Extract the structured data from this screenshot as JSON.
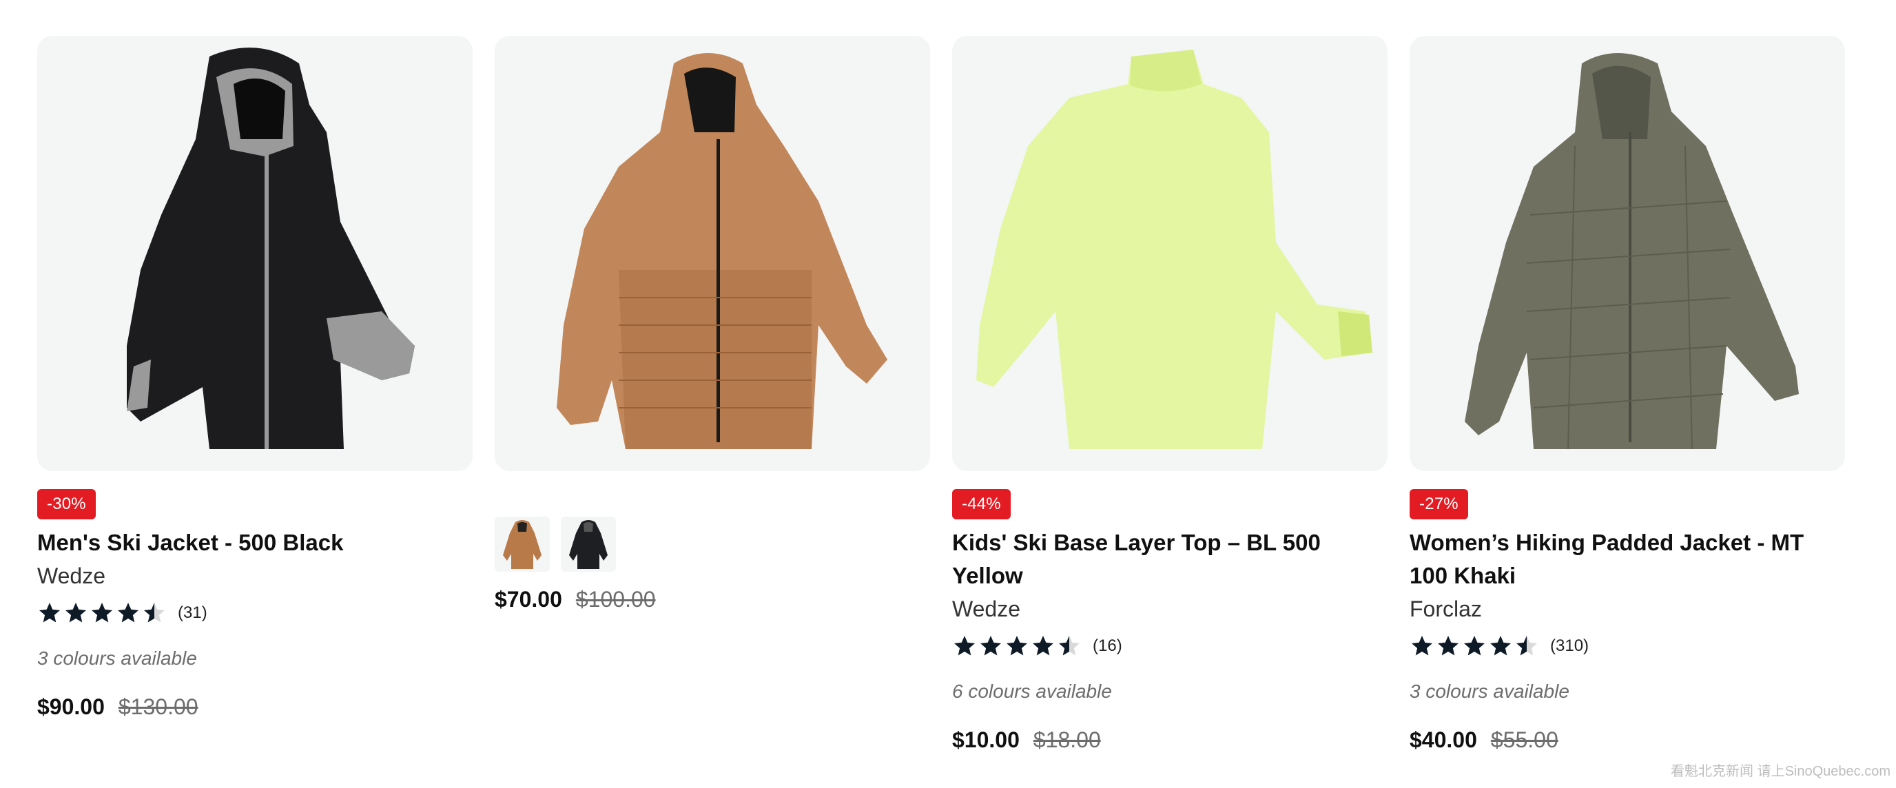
{
  "products": [
    {
      "badge": "-30%",
      "title": "Men's Ski Jacket - 500 Black",
      "brand": "Wedze",
      "rating": 4.5,
      "reviews": "(31)",
      "colours": "3 colours available",
      "price": "$90.00",
      "old_price": "$130.00",
      "image_icon": "black-ski-jacket-image",
      "colors": {
        "body": "#1c1c1e",
        "accent": "#9a9a9a"
      }
    },
    {
      "swatches": [
        {
          "icon": "brown-jacket-swatch",
          "color": "#b97a4a"
        },
        {
          "icon": "black-jacket-swatch",
          "color": "#1e1f22"
        }
      ],
      "price": "$70.00",
      "old_price": "$100.00",
      "image_icon": "brown-padded-jacket-image",
      "colors": {
        "body": "#c1875a",
        "accent": "#8b5530"
      }
    },
    {
      "badge": "-44%",
      "title": "Kids' Ski Base Layer Top – BL 500 Yellow",
      "brand": "Wedze",
      "rating": 4.5,
      "reviews": "(16)",
      "colours": "6 colours available",
      "price": "$10.00",
      "old_price": "$18.00",
      "image_icon": "yellow-base-layer-top-image",
      "colors": {
        "body": "#e4f6a2",
        "accent": "#cfe877"
      }
    },
    {
      "badge": "-27%",
      "title": "Women’s Hiking Padded Jacket - MT 100 Khaki",
      "brand": "Forclaz",
      "rating": 4.5,
      "reviews": "(310)",
      "colours": "3 colours available",
      "price": "$40.00",
      "old_price": "$55.00",
      "image_icon": "khaki-padded-jacket-image",
      "colors": {
        "body": "#6f705f",
        "accent": "#54564a"
      }
    }
  ],
  "watermark": "看魁北克新闻 请上SinoQuebec.com",
  "theme": {
    "badge": "#e31b23",
    "star": "#0e1a26",
    "card_bg": "#f4f5f5"
  }
}
